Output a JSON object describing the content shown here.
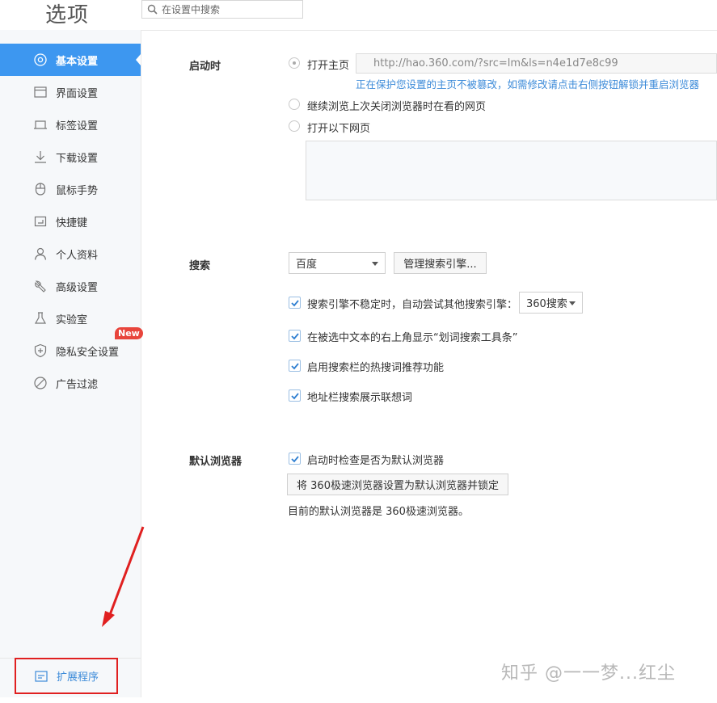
{
  "header": {
    "title": "选项",
    "search_placeholder": "在设置中搜索"
  },
  "sidebar": {
    "items": [
      {
        "label": "基本设置",
        "icon": "gear-icon",
        "active": true
      },
      {
        "label": "界面设置",
        "icon": "window-icon"
      },
      {
        "label": "标签设置",
        "icon": "tab-icon"
      },
      {
        "label": "下载设置",
        "icon": "download-icon"
      },
      {
        "label": "鼠标手势",
        "icon": "mouse-icon"
      },
      {
        "label": "快捷键",
        "icon": "keyboard-icon"
      },
      {
        "label": "个人资料",
        "icon": "user-icon"
      },
      {
        "label": "高级设置",
        "icon": "wrench-icon"
      },
      {
        "label": "实验室",
        "icon": "flask-icon"
      },
      {
        "label": "隐私安全设置",
        "icon": "shield-icon"
      },
      {
        "label": "广告过滤",
        "icon": "block-icon"
      }
    ],
    "new_badge": "New",
    "extensions_label": "扩展程序"
  },
  "startup": {
    "label": "启动时",
    "option_homepage": "打开主页",
    "homepage_url": "http://hao.360.com/?src=lm&ls=n4e1d7e8c99",
    "protect_note": "正在保护您设置的主页不被篡改，如需修改请点击右侧按钮解锁并重启浏览器",
    "option_continue": "继续浏览上次关闭浏览器时在看的网页",
    "option_pages": "打开以下网页"
  },
  "search": {
    "label": "搜索",
    "engine_selected": "百度",
    "manage_button": "管理搜索引擎...",
    "fallback_text": "搜索引擎不稳定时，自动尝试其他搜索引擎：",
    "fallback_selected": "360搜索",
    "option_toolbar": "在被选中文本的右上角显示“划词搜索工具条”",
    "option_hotwords": "启用搜索栏的热搜词推荐功能",
    "option_suggest": "地址栏搜索展示联想词"
  },
  "default_browser": {
    "label": "默认浏览器",
    "check_option": "启动时检查是否为默认浏览器",
    "set_button": "将 360极速浏览器设置为默认浏览器并锁定",
    "status": "目前的默认浏览器是 360极速浏览器。"
  },
  "watermark": "知乎 @一一梦...红尘",
  "colors": {
    "accent": "#3d97f0",
    "link": "#3d8bd9",
    "annotation": "#e02020"
  }
}
